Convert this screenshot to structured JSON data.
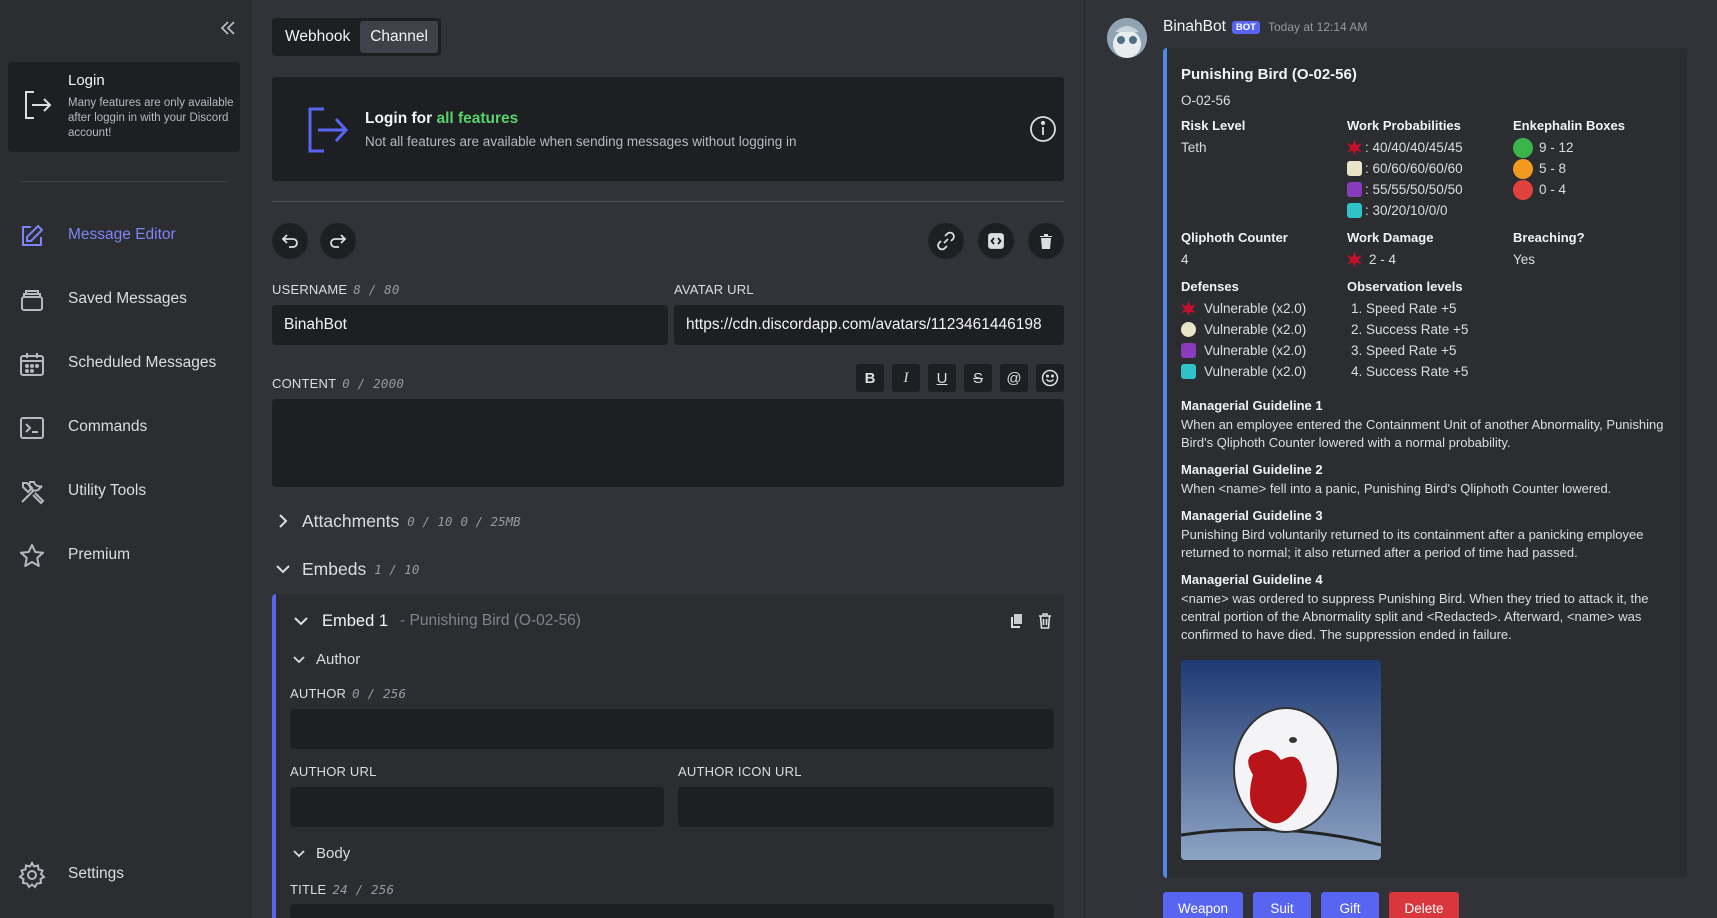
{
  "sidebar": {
    "login": {
      "title": "Login",
      "description": "Many features are only available after loggin in with your Discord account!"
    },
    "items": [
      {
        "label": "Message Editor",
        "icon": "edit-icon",
        "active": true
      },
      {
        "label": "Saved Messages",
        "icon": "saved-icon"
      },
      {
        "label": "Scheduled Messages",
        "icon": "calendar-icon"
      },
      {
        "label": "Commands",
        "icon": "terminal-icon"
      },
      {
        "label": "Utility Tools",
        "icon": "tools-icon"
      },
      {
        "label": "Premium",
        "icon": "star-icon"
      }
    ],
    "settings_label": "Settings"
  },
  "editor": {
    "tabs": [
      "Webhook",
      "Channel"
    ],
    "selected_tab": "Channel",
    "login_banner": {
      "title_prefix": "Login for ",
      "title_highlight": "all features",
      "description": "Not all features are available when sending messages without logging in"
    },
    "username": {
      "label": "Username",
      "count": "8 / 80",
      "value": "BinahBot"
    },
    "avatar_url": {
      "label": "Avatar URL",
      "value": "https://cdn.discordapp.com/avatars/1123461446198"
    },
    "content": {
      "label": "Content",
      "count": "0 / 2000",
      "value": "",
      "format_buttons": [
        "B",
        "I",
        "U",
        "S",
        "@",
        "emoji"
      ]
    },
    "attachments": {
      "label": "Attachments",
      "count": "0 / 10",
      "size": "0 / 25MB"
    },
    "embeds": {
      "label": "Embeds",
      "count": "1 / 10"
    },
    "embed1": {
      "label": "Embed 1",
      "subtitle": "- Punishing Bird (O-02-56)",
      "author_section": "Author",
      "author": {
        "label": "Author",
        "count": "0 / 256",
        "value": ""
      },
      "author_url": {
        "label": "Author URL",
        "value": ""
      },
      "author_icon_url": {
        "label": "Author Icon URL",
        "value": ""
      },
      "body_section": "Body",
      "title": {
        "label": "Title",
        "count": "24 / 256"
      }
    }
  },
  "preview": {
    "username": "BinahBot",
    "badge": "BOT",
    "timestamp": "Today at 12:14 AM",
    "embed": {
      "color": "#4e8be9",
      "title": "Punishing Bird (O-02-56)",
      "description": "O-02-56",
      "fields": {
        "risk_level": {
          "name": "Risk Level",
          "value": "Teth"
        },
        "work_prob": {
          "name": "Work Probabilities",
          "lines": [
            ": 40/40/40/45/45",
            ": 60/60/60/60/60",
            ": 55/55/50/50/50",
            ": 30/20/10/0/0"
          ]
        },
        "enkephalin": {
          "name": "Enkephalin Boxes",
          "lines": [
            "9 - 12",
            "5 - 8",
            "0 - 4"
          ]
        },
        "qliphoth": {
          "name": "Qliphoth Counter",
          "value": "4"
        },
        "work_damage": {
          "name": "Work Damage",
          "value": "2 - 4"
        },
        "breaching": {
          "name": "Breaching?",
          "value": "Yes"
        },
        "defenses": {
          "name": "Defenses",
          "lines": [
            "Vulnerable (x2.0)",
            "Vulnerable (x2.0)",
            "Vulnerable (x2.0)",
            "Vulnerable (x2.0)"
          ]
        },
        "observation": {
          "name": "Observation levels",
          "lines": [
            "1. Speed Rate +5",
            "2. Success Rate +5",
            "3. Speed Rate +5",
            "4. Success Rate +5"
          ]
        }
      },
      "guidelines": [
        {
          "name": "Managerial Guideline 1",
          "value": "When an employee entered the Containment Unit of another Abnormality, Punishing Bird's Qliphoth Counter lowered with a normal probability."
        },
        {
          "name": "Managerial Guideline 2",
          "value": "When <name> fell into a panic, Punishing Bird's Qliphoth Counter lowered."
        },
        {
          "name": "Managerial Guideline 3",
          "value": "Punishing Bird voluntarily returned to its containment after a panicking employee returned to normal; it also returned after a period of time had passed."
        },
        {
          "name": "Managerial Guideline 4",
          "value": "<name> was ordered to suppress Punishing Bird. When they tried to attack it, the central portion of the Abnormality split and <Redacted>. Afterward, <name> was confirmed to have died. The suppression ended in failure."
        }
      ]
    },
    "buttons": [
      {
        "label": "Weapon",
        "color": "#5865f2"
      },
      {
        "label": "Suit",
        "color": "#5865f2"
      },
      {
        "label": "Gift",
        "color": "#5865f2"
      },
      {
        "label": "Delete",
        "color": "#da373c"
      }
    ]
  }
}
